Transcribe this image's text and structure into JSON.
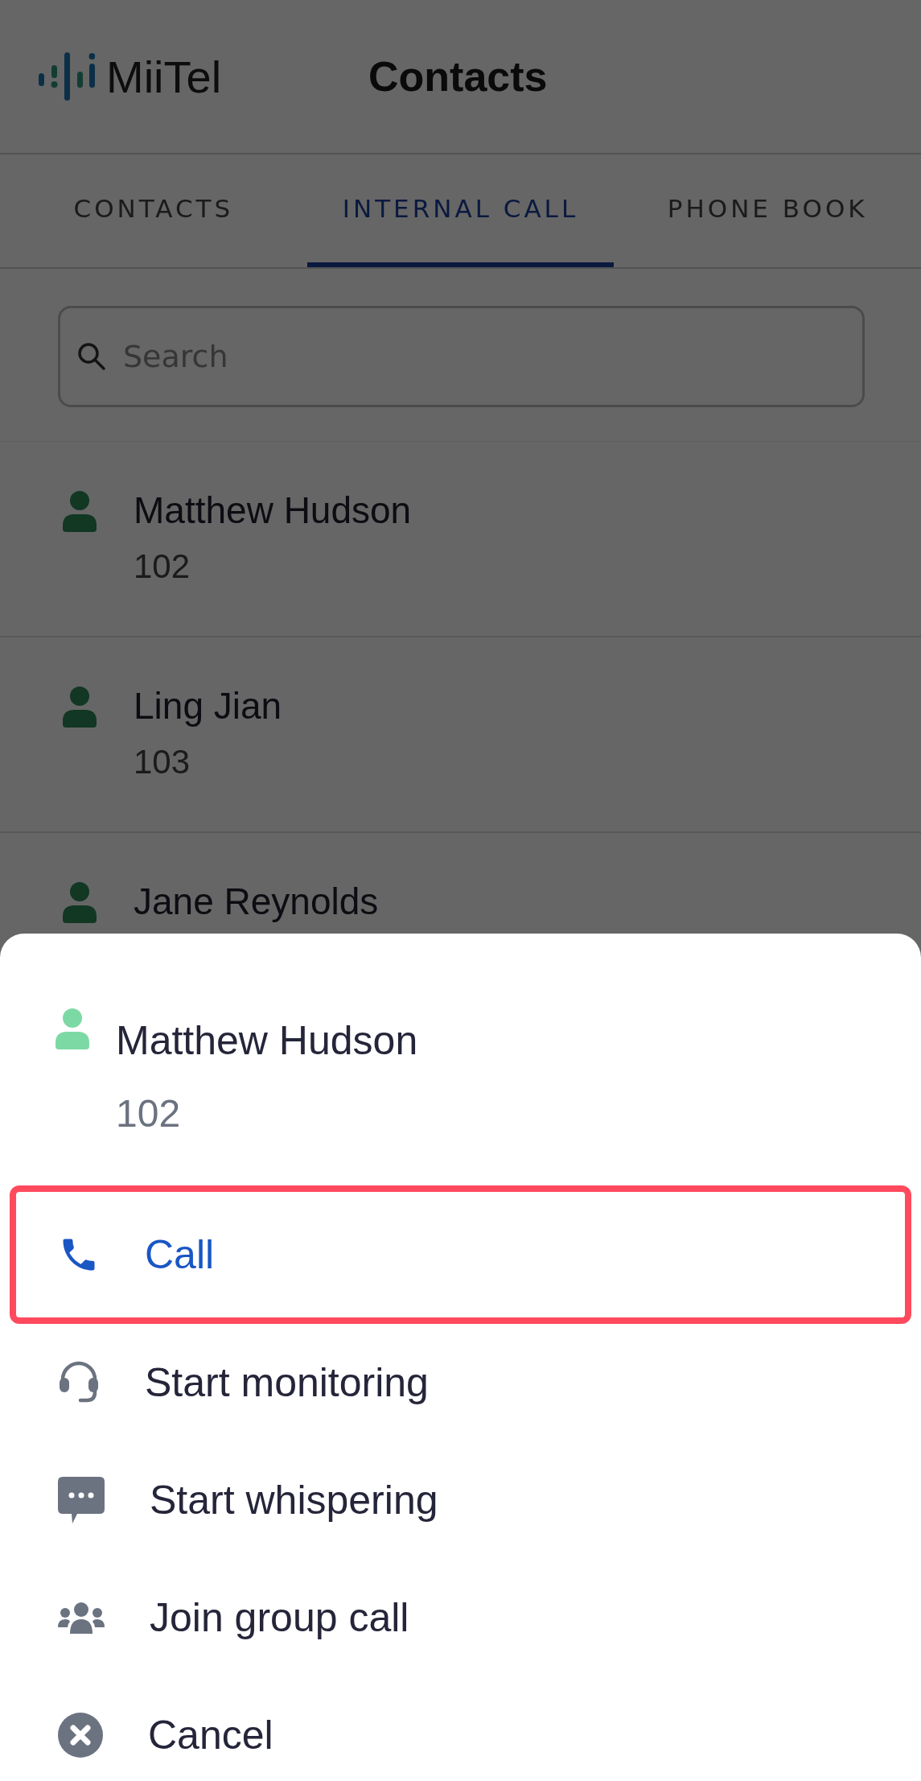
{
  "header": {
    "logo_text": "MiiTel",
    "title": "Contacts"
  },
  "tabs": [
    {
      "label": "CONTACTS",
      "selected": false
    },
    {
      "label": "INTERNAL CALL",
      "selected": true
    },
    {
      "label": "PHONE BOOK",
      "selected": false
    }
  ],
  "search": {
    "placeholder": "Search"
  },
  "contacts": [
    {
      "name": "Matthew Hudson",
      "extension": "102"
    },
    {
      "name": "Ling Jian",
      "extension": "103"
    },
    {
      "name": "Jane Reynolds"
    }
  ],
  "action_sheet": {
    "contact": {
      "name": "Matthew Hudson",
      "extension": "102"
    },
    "actions": [
      {
        "kind": "call",
        "label": "Call",
        "highlighted": true
      },
      {
        "kind": "monitor",
        "label": "Start monitoring",
        "highlighted": false
      },
      {
        "kind": "whisper",
        "label": "Start whispering",
        "highlighted": false
      },
      {
        "kind": "group",
        "label": "Join group call",
        "highlighted": false
      },
      {
        "kind": "cancel",
        "label": "Cancel",
        "highlighted": false
      }
    ]
  }
}
